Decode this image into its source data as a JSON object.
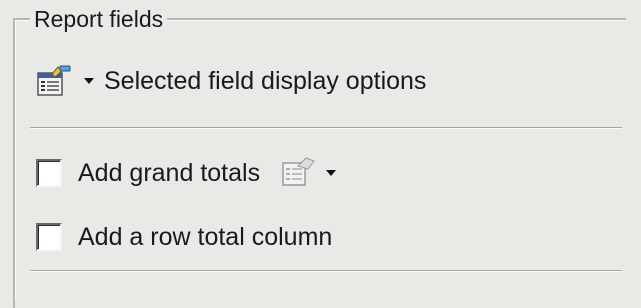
{
  "groupbox": {
    "title": "Report fields"
  },
  "display_options": {
    "label": "Selected field display options",
    "icon": "field-properties-icon"
  },
  "grand_totals": {
    "label": "Add grand totals",
    "checked": false,
    "icon": "totals-options-icon"
  },
  "row_total": {
    "label": "Add a row total column",
    "checked": false
  },
  "colors": {
    "background": "#e9e9e6",
    "border": "#b6b6b2"
  }
}
